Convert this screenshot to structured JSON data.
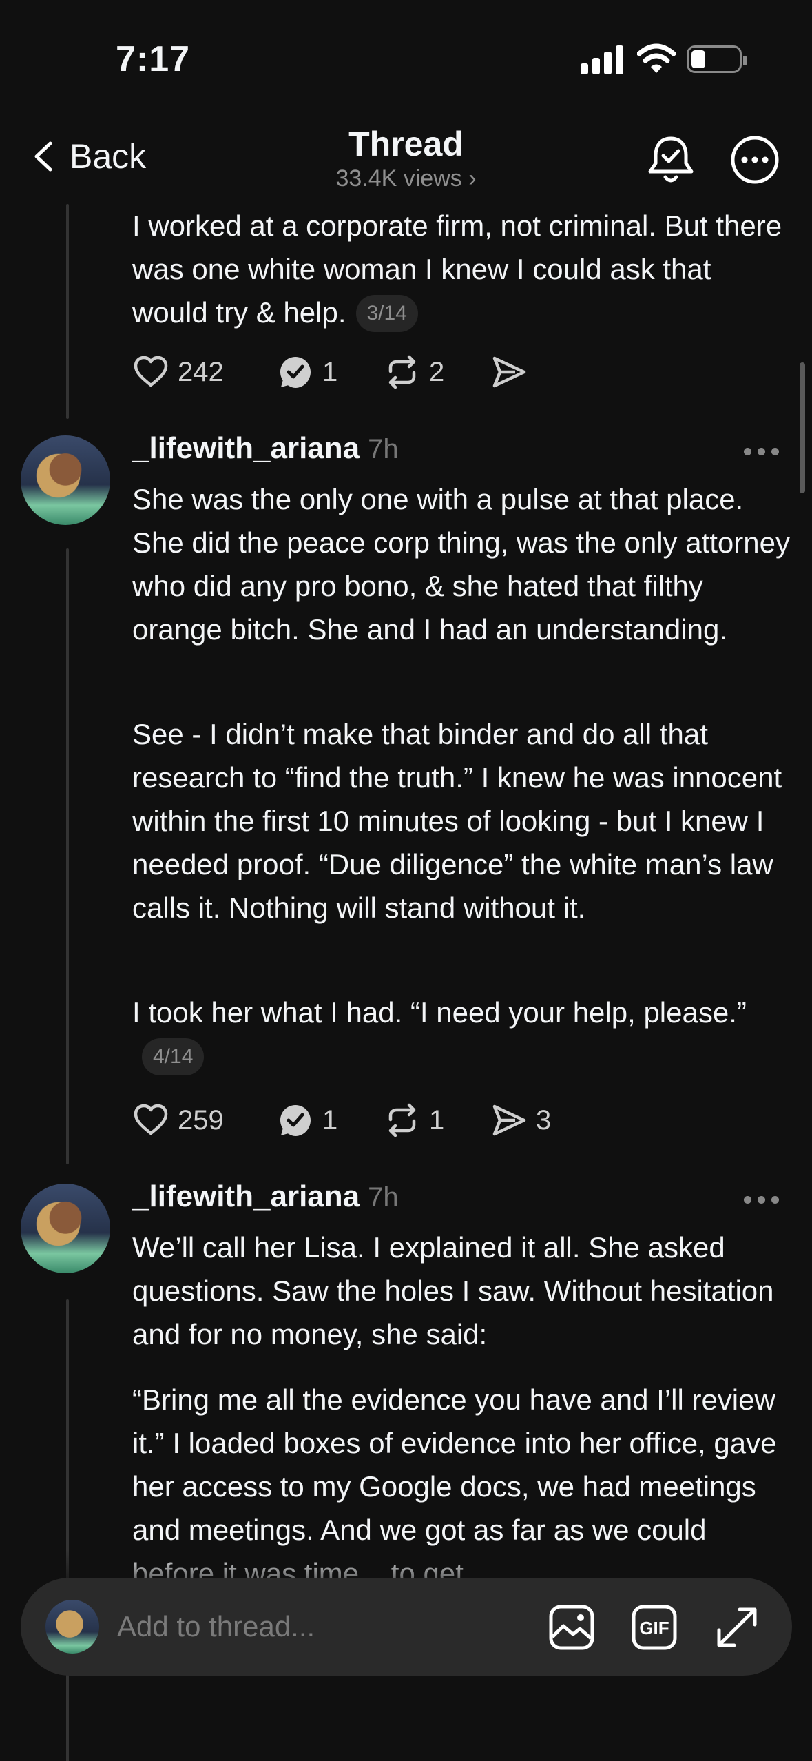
{
  "status": {
    "time": "7:17"
  },
  "nav": {
    "back_label": "Back",
    "title": "Thread",
    "views": "33.4K views ›"
  },
  "posts": [
    {
      "username": "",
      "time": "",
      "paragraphs": [
        "I worked at a corporate firm, not criminal. But there was one white woman I knew I could ask that would try & help."
      ],
      "counter": "3/14",
      "likes": "242",
      "replies": "1",
      "reposts": "2",
      "shares": ""
    },
    {
      "username": "_lifewith_ariana",
      "time": "7h",
      "paragraphs": [
        "She was the only one with a pulse at that place. She did the peace corp thing, was the only attorney who did any pro bono, & she hated that filthy orange bitch. She and I had an understanding.",
        "See - I didn’t make that binder and do all that research to “find the truth.” I knew he was innocent within the first 10 minutes of looking - but I knew I needed proof. “Due diligence” the white man’s law calls it. Nothing will stand without it.",
        "I took her what I had. “I need your help, please.”"
      ],
      "counter": "4/14",
      "likes": "259",
      "replies": "1",
      "reposts": "1",
      "shares": "3"
    },
    {
      "username": "_lifewith_ariana",
      "time": "7h",
      "paragraphs": [
        "We’ll call her Lisa. I explained it all. She asked questions. Saw the holes I saw. Without hesitation and for no money, she said:",
        "“Bring me all the evidence you have and I’ll review it.” I loaded boxes of evidence into her office, gave her access to my Google docs, we had meetings and meetings. And we got as far as we could before it was time... to get"
      ]
    }
  ],
  "composer": {
    "placeholder": "Add to thread..."
  },
  "icons": [
    "chevron-left-icon",
    "bell-check-icon",
    "more-circle-icon",
    "heart-icon",
    "reply-icon",
    "repost-icon",
    "share-icon",
    "image-icon",
    "gif-icon",
    "expand-icon"
  ]
}
